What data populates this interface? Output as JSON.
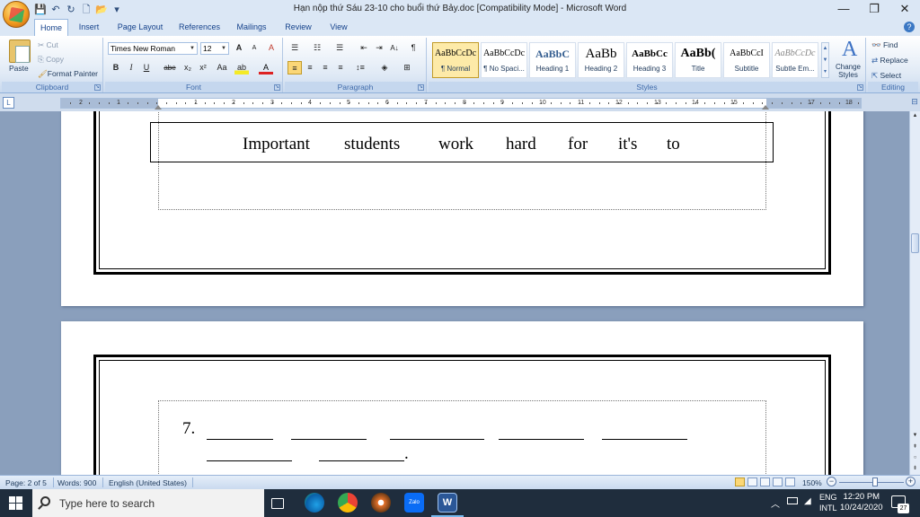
{
  "window": {
    "title": "Hạn nộp thứ Sáu 23-10 cho buổi thứ Bảy.doc [Compatibility Mode] - Microsoft Word",
    "minimize": "—",
    "maximize": "❐",
    "close": "✕"
  },
  "qat": {
    "save": "💾",
    "undo": "↶",
    "redo": "↻",
    "new": "🗋",
    "open": "📂",
    "more": "▾"
  },
  "tabs": [
    "Home",
    "Insert",
    "Page Layout",
    "References",
    "Mailings",
    "Review",
    "View"
  ],
  "active_tab": "Home",
  "clipboard": {
    "label": "Clipboard",
    "paste": "Paste",
    "cut": "Cut",
    "copy": "Copy",
    "format_painter": "Format Painter"
  },
  "font": {
    "label": "Font",
    "name": "Times New Roman",
    "size": "12",
    "grow": "A",
    "shrink": "A",
    "clear": "A",
    "bold": "B",
    "italic": "I",
    "underline": "U",
    "strike": "abe",
    "subscript": "x₂",
    "superscript": "x²",
    "change_case": "Aa",
    "highlight": "ab",
    "color": "A"
  },
  "paragraph": {
    "label": "Paragraph",
    "bullets": "☰",
    "numbering": "☷",
    "multilevel": "☰",
    "decrease_indent": "⇤",
    "increase_indent": "⇥",
    "sort": "A↓",
    "show_marks": "¶"
  },
  "styles": {
    "label": "Styles",
    "items": [
      {
        "preview": "AaBbCcDc",
        "name": "¶ Normal"
      },
      {
        "preview": "AaBbCcDc",
        "name": "¶ No Spaci..."
      },
      {
        "preview": "AaBbC",
        "name": "Heading 1"
      },
      {
        "preview": "AaBb",
        "name": "Heading 2"
      },
      {
        "preview": "AaBbCc",
        "name": "Heading 3"
      },
      {
        "preview": "AaBb(",
        "name": "Title"
      },
      {
        "preview": "AaBbCcI",
        "name": "Subtitle"
      },
      {
        "preview": "AaBbCcDc",
        "name": "Subtle Em..."
      }
    ],
    "change_styles": "Change Styles"
  },
  "editing": {
    "label": "Editing",
    "find": "Find",
    "replace": "Replace",
    "select": "Select"
  },
  "ruler": {
    "numbers": [
      "2",
      "1",
      "1",
      "2",
      "3",
      "4",
      "5",
      "6",
      "7",
      "8",
      "9",
      "10",
      "11",
      "12",
      "13",
      "14",
      "15",
      "17",
      "18"
    ]
  },
  "document": {
    "word_box": [
      "Important",
      "students",
      "work",
      "hard",
      "for",
      "it's",
      "to"
    ],
    "question_number": "7."
  },
  "status": {
    "page": "Page: 2 of 5",
    "words": "Words: 900",
    "language": "English (United States)",
    "zoom": "150%",
    "zoom_minus": "−",
    "zoom_plus": "+"
  },
  "taskbar": {
    "search_placeholder": "Type here to search",
    "lang_line1": "ENG",
    "lang_line2": "INTL",
    "time": "12:20 PM",
    "date": "10/24/2020",
    "notifications": "27"
  }
}
